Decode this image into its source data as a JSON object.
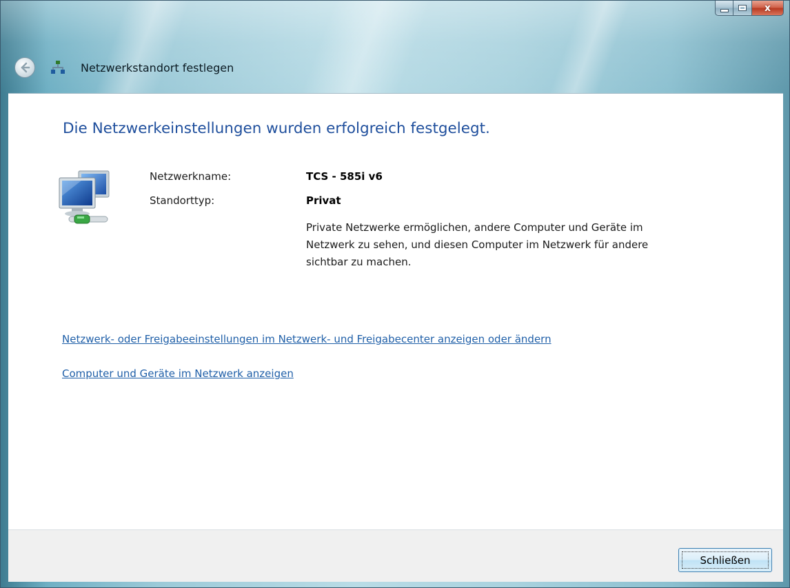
{
  "window": {
    "title": "Netzwerkstandort festlegen",
    "caption_buttons": {
      "minimize": "minimize-icon",
      "maximize": "maximize-icon",
      "close": "close-icon",
      "close_glyph": "x"
    }
  },
  "header": {
    "back_icon": "back-arrow-icon",
    "network_icon": "network-icon"
  },
  "main": {
    "heading": "Die Netzwerkeinstellungen wurden erfolgreich festgelegt.",
    "details": {
      "network_name_label": "Netzwerkname:",
      "network_name_value": "TCS - 585i v6",
      "location_type_label": "Standorttyp:",
      "location_type_value": "Privat",
      "description": "Private Netzwerke ermöglichen, andere Computer und Geräte im Netzwerk zu sehen, und diesen Computer im Netzwerk für andere sichtbar zu machen."
    },
    "links": [
      "Netzwerk- oder Freigabeeinstellungen im Netzwerk- und Freigabecenter anzeigen oder ändern",
      "Computer und Geräte im Netzwerk anzeigen"
    ]
  },
  "footer": {
    "close_button_label": "Schließen"
  },
  "colors": {
    "heading": "#1e4e9c",
    "link": "#1f5fa8",
    "footer_bg": "#f0f0f0",
    "close_caption": "#c8452c"
  }
}
